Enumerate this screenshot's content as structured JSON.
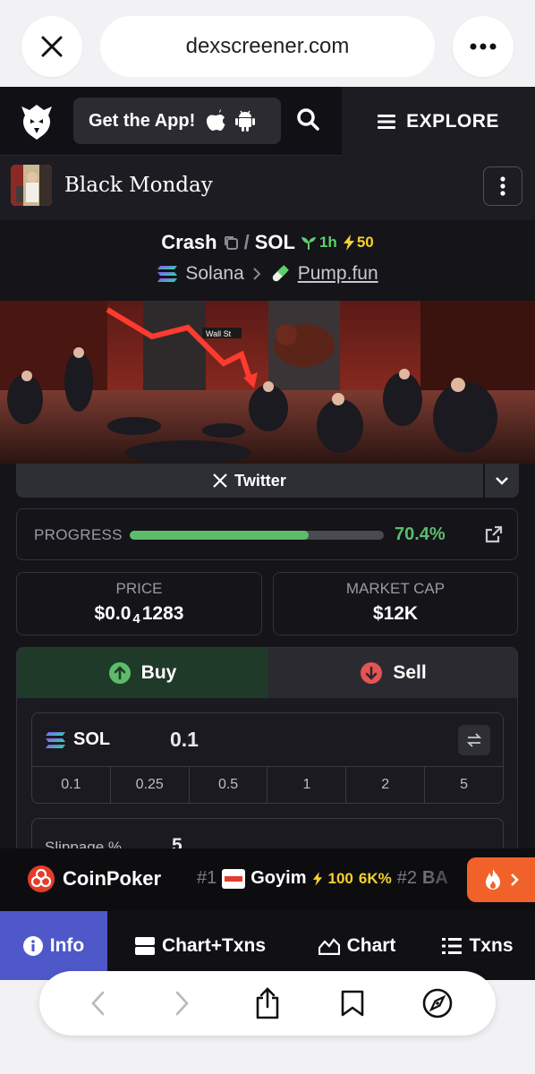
{
  "browser": {
    "url": "dexscreener.com",
    "close_icon": "close-icon",
    "more_icon": "more-horizontal-icon"
  },
  "header": {
    "logo_icon": "dexscreener-logo-icon",
    "get_app_label": "Get the App!",
    "search_icon": "search-icon",
    "explore_label": "EXPLORE"
  },
  "token": {
    "name": "Black Monday",
    "symbol": "Crash",
    "quote": "SOL",
    "separator": "/",
    "age": "1h",
    "boosts": "50",
    "chain": "Solana",
    "dex": "Pump.fun"
  },
  "banner": {
    "sign_text": "Wall St"
  },
  "socials": {
    "twitter_label": "Twitter"
  },
  "progress": {
    "label": "PROGRESS",
    "value_text": "70.4%",
    "fraction": 0.704
  },
  "stats": {
    "price_label": "PRICE",
    "price_prefix": "$0.0",
    "price_subscript": "4",
    "price_suffix": "1283",
    "mcap_label": "MARKET CAP",
    "mcap_value": "$12K"
  },
  "trade": {
    "buy_label": "Buy",
    "sell_label": "Sell",
    "token_label": "SOL",
    "amount": "0.1",
    "quick_amounts": [
      "0.1",
      "0.25",
      "0.5",
      "1",
      "2",
      "5"
    ],
    "slippage_label": "Slippage %",
    "slippage_value": "5"
  },
  "ticker": {
    "sponsor": "CoinPoker",
    "trend1_rank": "#1",
    "trend1_name": "Goyim",
    "trend1_boost": "100",
    "trend1_change": "6K%",
    "trend2_rank": "#2",
    "trend2_name": "BA"
  },
  "nav": {
    "info": "Info",
    "chart_txns": "Chart+Txns",
    "chart": "Chart",
    "txns": "Txns"
  },
  "colors": {
    "accent_green": "#5dbc6c",
    "sell_red": "#e55454",
    "info_blue": "#4e58c9",
    "hot_orange": "#f0622a",
    "boost_yellow": "#f5d130"
  }
}
